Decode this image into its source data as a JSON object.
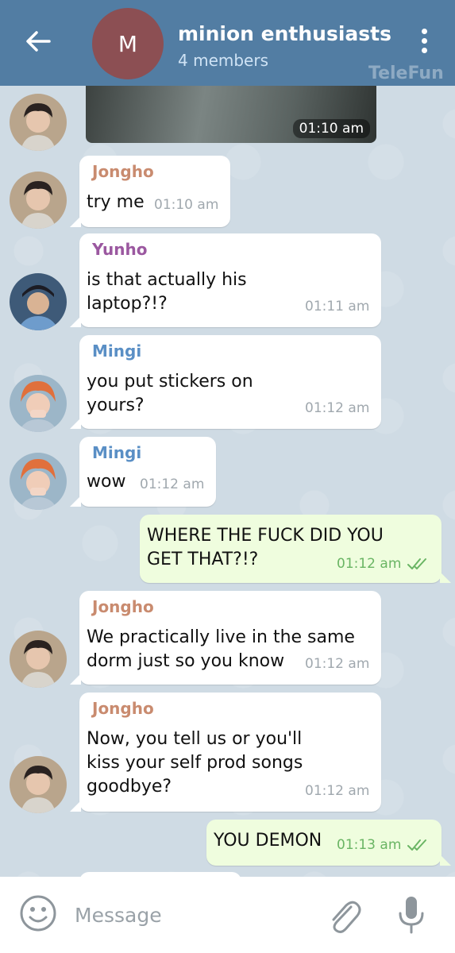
{
  "header": {
    "title": "minion enthusiasts",
    "subtitle": "4 members",
    "avatar_letter": "M",
    "avatar_color": "#8c4f53",
    "watermark": "TeleFun",
    "back_icon": "arrow-left-icon",
    "menu_icon": "more-vertical-icon"
  },
  "colors": {
    "header": "#527da3",
    "jongho": "#c98b6f",
    "yunho": "#9b58a0",
    "mingi": "#5a8fc5",
    "outgoing_bubble": "#effdde",
    "outgoing_time": "#6ab564"
  },
  "photo_message": {
    "time": "01:10 am"
  },
  "messages": [
    {
      "sender": "Jongho",
      "lines": [
        "try me"
      ],
      "time": "01:10 am"
    },
    {
      "sender": "Yunho",
      "lines": [
        "is that actually his",
        "laptop?!?"
      ],
      "time": "01:11 am"
    },
    {
      "sender": "Mingi",
      "lines": [
        "you put stickers on",
        "yours?"
      ],
      "time": "01:12 am"
    },
    {
      "sender": "Mingi",
      "lines": [
        "wow"
      ],
      "time": "01:12 am"
    },
    {
      "sender": "",
      "lines": [
        "WHERE THE FUCK DID YOU",
        "GET THAT?!?"
      ],
      "time": "01:12 am",
      "read": true
    },
    {
      "sender": "Jongho",
      "lines": [
        "We practically live in the same",
        "dorm just so you know"
      ],
      "time": "01:12 am"
    },
    {
      "sender": "Jongho",
      "lines": [
        "Now, you tell us or you'll",
        "kiss your self prod songs",
        "goodbye?"
      ],
      "time": "01:12 am"
    },
    {
      "sender": "",
      "lines": [
        "YOU DEMON"
      ],
      "time": "01:13 am",
      "read": true
    }
  ],
  "input": {
    "placeholder": "Message",
    "emoji_icon": "smile-icon",
    "attach_icon": "paperclip-icon",
    "mic_icon": "microphone-icon"
  }
}
